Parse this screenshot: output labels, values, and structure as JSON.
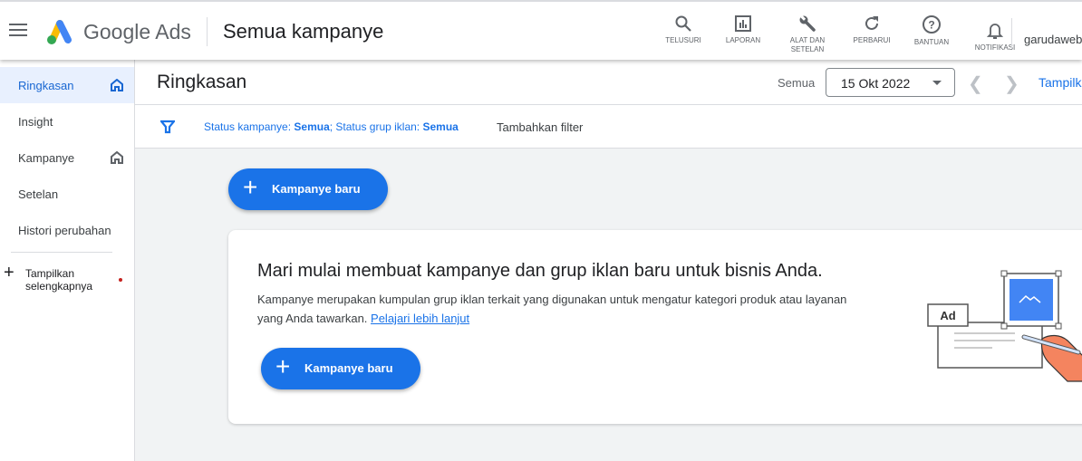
{
  "header": {
    "brand": "Google Ads",
    "title": "Semua kampanye",
    "account": "garudaweb.",
    "tools": [
      {
        "label": "TELUSURI",
        "icon": "search-icon"
      },
      {
        "label": "LAPORAN",
        "icon": "report-icon"
      },
      {
        "label": "ALAT DAN SETELAN",
        "icon": "wrench-icon"
      },
      {
        "label": "PERBARUI",
        "icon": "refresh-icon"
      },
      {
        "label": "BANTUAN",
        "icon": "help-icon"
      },
      {
        "label": "NOTIFIKASI",
        "icon": "bell-icon"
      }
    ]
  },
  "sidebar": {
    "items": [
      {
        "label": "Ringkasan"
      },
      {
        "label": "Insight"
      },
      {
        "label": "Kampanye"
      },
      {
        "label": "Setelan"
      },
      {
        "label": "Histori perubahan"
      }
    ],
    "more": "Tampilkan selengkapnya"
  },
  "subheader": {
    "title": "Ringkasan",
    "range_label": "Semua",
    "date": "15 Okt 2022",
    "view": "Tampilk"
  },
  "filter": {
    "prefix1": "Status kampanye: ",
    "value1": "Semua",
    "prefix2": "; Status grup iklan: ",
    "value2": "Semua",
    "add": "Tambahkan filter"
  },
  "main": {
    "new_campaign": "Kampanye baru",
    "card": {
      "title": "Mari mulai membuat kampanye dan grup iklan baru untuk bisnis Anda.",
      "body": "Kampanye merupakan kumpulan grup iklan terkait yang digunakan untuk mengatur kategori produk atau layanan yang Anda tawarkan. ",
      "link": "Pelajari lebih lanjut",
      "button": "Kampanye baru",
      "illustration_label": "Ad"
    }
  },
  "colors": {
    "accent": "#1a73e8",
    "active_bg": "#e8f0fe"
  }
}
